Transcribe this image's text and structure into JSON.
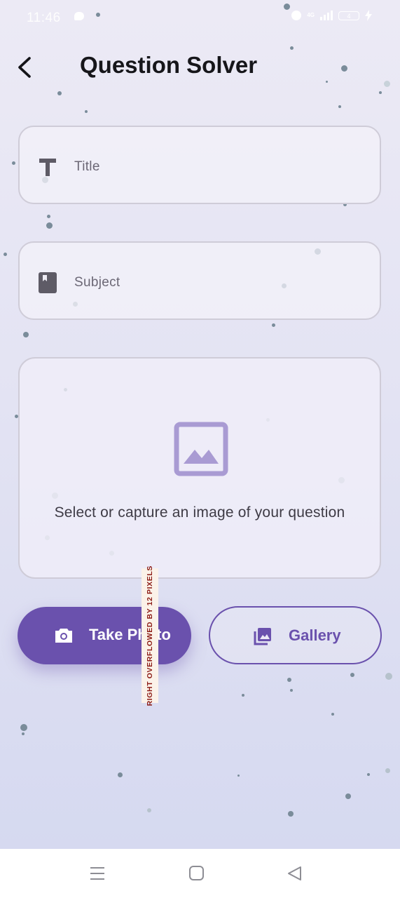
{
  "status_bar": {
    "time": "11:46",
    "network": "4G",
    "battery": "4"
  },
  "header": {
    "title": "Question Solver"
  },
  "form": {
    "title_placeholder": "Title",
    "subject_placeholder": "Subject"
  },
  "image_picker": {
    "caption": "Select or capture an image of your question"
  },
  "actions": {
    "take_photo_label": "Take Photo",
    "gallery_label": "Gallery"
  },
  "debug": {
    "overflow_text": "RIGHT OVERFLOWED BY 12 PIXELS"
  },
  "icons": {
    "back": "chevron-left-icon",
    "title_field": "text-t-icon",
    "subject_field": "book-icon",
    "image_placeholder": "image-icon",
    "take_photo": "camera-icon",
    "gallery": "photo-library-icon",
    "nav_menu": "menu-icon",
    "nav_home": "square-home-icon",
    "nav_back": "triangle-back-icon"
  },
  "colors": {
    "primary": "#6a51ad",
    "placeholder_icon": "#a99bd3",
    "field_border": "#cfccd8"
  }
}
